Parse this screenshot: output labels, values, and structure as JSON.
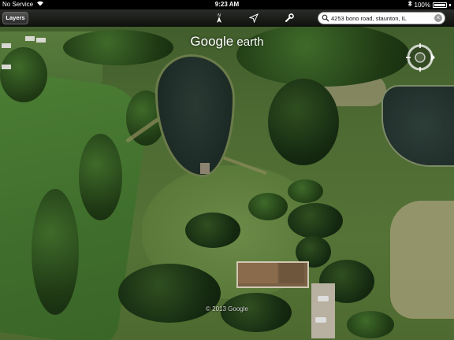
{
  "status_bar": {
    "carrier": "No Service",
    "time": "9:23 AM",
    "battery": "100%"
  },
  "toolbar": {
    "layers_label": "Layers",
    "search": {
      "value": "4253 bono road, staunton, IL"
    },
    "icons": [
      "north-arrow-icon",
      "location-arrow-icon",
      "wrench-icon",
      "search-icon",
      "clear-icon"
    ]
  },
  "map": {
    "logo_google": "Google",
    "logo_earth": "earth",
    "copyright": "© 2013 Google"
  }
}
